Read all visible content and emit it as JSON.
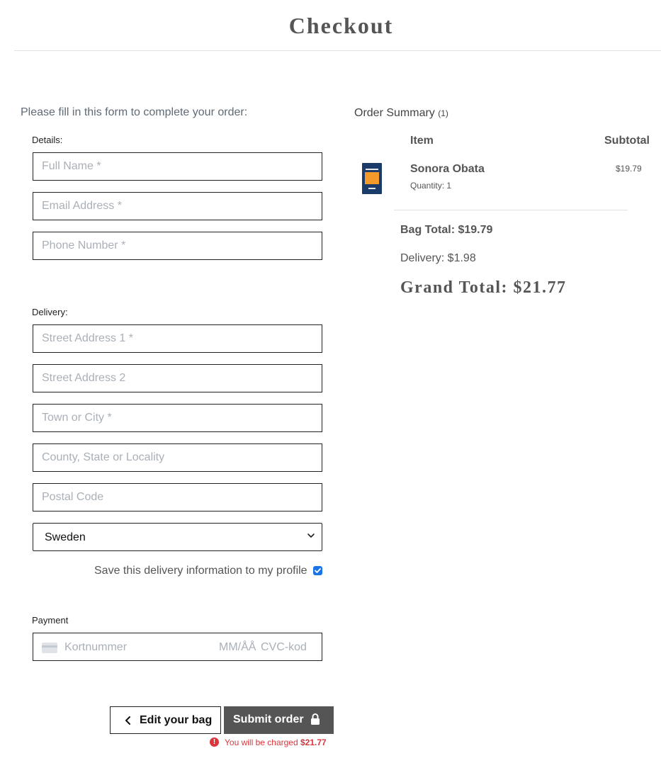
{
  "header": {
    "title": "Checkout"
  },
  "form": {
    "intro": "Please fill in this form to complete your order:",
    "details_label": "Details:",
    "details_fields": {
      "full_name": "Full Name *",
      "email": "Email Address *",
      "phone": "Phone Number *"
    },
    "delivery_label": "Delivery:",
    "delivery_fields": {
      "street1": "Street Address 1 *",
      "street2": "Street Address 2",
      "town": "Town or City *",
      "county": "County, State or Locality",
      "postal": "Postal Code"
    },
    "country": {
      "selected": "Sweden"
    },
    "save_info": {
      "label": "Save this delivery information to my profile",
      "checked": true
    },
    "payment_label": "Payment",
    "card": {
      "number_placeholder": "Kortnummer",
      "date_placeholder": "MM/ÅÅ",
      "cvc_placeholder": "CVC-kod"
    }
  },
  "actions": {
    "edit_bag": "Edit your bag",
    "submit": "Submit order",
    "charge_prefix": "You will be charged",
    "charge_amount": "$21.77"
  },
  "summary": {
    "title": "Order Summary",
    "count": "(1)",
    "col_item": "Item",
    "col_subtotal": "Subtotal",
    "items": [
      {
        "name": "Sonora Obata",
        "quantity": "Quantity: 1",
        "subtotal": "$19.79"
      }
    ],
    "bag_total": "Bag Total: $19.79",
    "delivery": "Delivery: $1.98",
    "grand_total": "Grand Total: $21.77"
  },
  "colors": {
    "accent": "#555555",
    "error": "#d9363e",
    "checkbox": "#1a73e8"
  }
}
